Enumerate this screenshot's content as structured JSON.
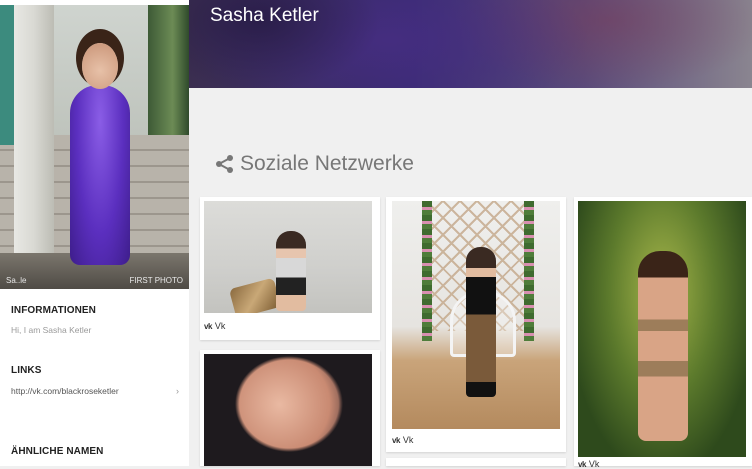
{
  "profile": {
    "name": "Sasha Ketler",
    "avatar_watermark_left": "Sa..le",
    "avatar_watermark_right": "FIRST PHOTO"
  },
  "sidebar": {
    "info_heading": "INFORMATIONEN",
    "info_text": "Hi, I am Sasha Ketler",
    "links_heading": "LINKS",
    "links": [
      {
        "label": "http://vk.com/blackroseketler"
      }
    ],
    "similar_heading": "ÄHNLICHE NAMEN"
  },
  "social": {
    "heading": "Soziale Netzwerke",
    "icon": "share-icon"
  },
  "cards": [
    {
      "network": "Vk",
      "icon": "vk-icon"
    },
    {
      "network": "Vk",
      "icon": "vk-icon"
    },
    {
      "network": "Vk",
      "icon": "vk-icon"
    }
  ],
  "colors": {
    "sidebar_bg": "#ffffff",
    "page_bg": "#f0f0f0",
    "heading_text": "#222222",
    "muted_text": "#9a9a9a",
    "banner_base": "#3a2c74"
  }
}
